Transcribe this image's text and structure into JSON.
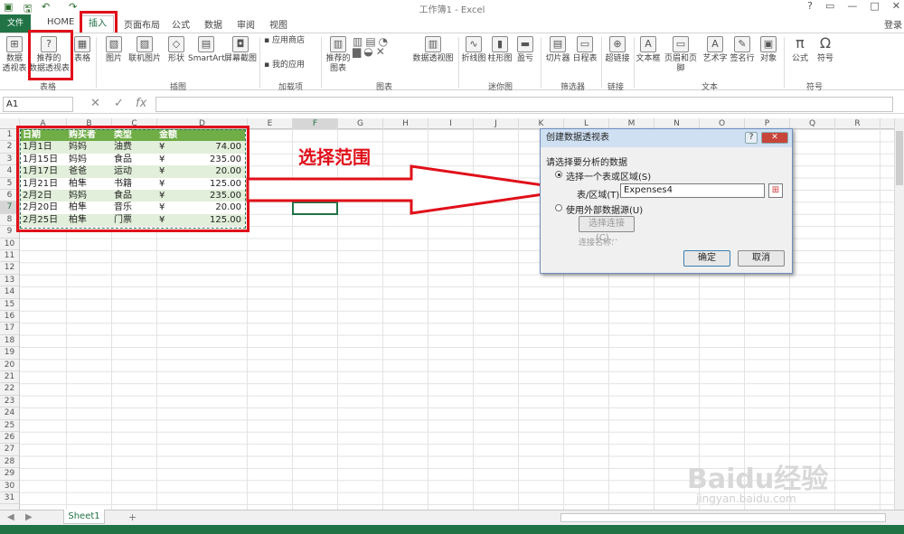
{
  "window": {
    "title": "工作簿1 - Excel",
    "login": "登录",
    "controls": [
      "?",
      "▭",
      "—",
      "□",
      "✕"
    ]
  },
  "tabs": [
    {
      "label": "文件"
    },
    {
      "label": "HOME"
    },
    {
      "label": "插入"
    },
    {
      "label": "页面布局"
    },
    {
      "label": "公式"
    },
    {
      "label": "数据"
    },
    {
      "label": "审阅"
    },
    {
      "label": "视图"
    }
  ],
  "ribbon": {
    "buttons": [
      {
        "label": "数据\n透视表"
      },
      {
        "label": "推荐的\n数据透视表"
      },
      {
        "label": "表格"
      },
      {
        "label": "图片"
      },
      {
        "label": "联机图片"
      },
      {
        "label": "形状"
      },
      {
        "label": "SmartArt"
      },
      {
        "label": "屏幕截图"
      },
      {
        "label": "应用商店"
      },
      {
        "label": "我的应用"
      },
      {
        "label": "推荐的\n图表"
      },
      {
        "label": "数据透视图"
      },
      {
        "label": "折线图"
      },
      {
        "label": "柱形图"
      },
      {
        "label": "盈亏"
      },
      {
        "label": "切片器"
      },
      {
        "label": "日程表"
      },
      {
        "label": "超链接"
      },
      {
        "label": "文本框"
      },
      {
        "label": "页眉和页脚"
      },
      {
        "label": "艺术字"
      },
      {
        "label": "签名行"
      },
      {
        "label": "对象"
      },
      {
        "label": "公式"
      },
      {
        "label": "符号"
      }
    ],
    "groups": [
      "表格",
      "插图",
      "加载项",
      "图表",
      "迷你图",
      "筛选器",
      "链接",
      "文本",
      "符号"
    ]
  },
  "formula_bar": {
    "name_box": "A1",
    "icons": [
      "✕",
      "✓",
      "fx"
    ],
    "value": ""
  },
  "columns": [
    "A",
    "B",
    "C",
    "D",
    "E",
    "F",
    "G",
    "H",
    "I",
    "J",
    "K",
    "L",
    "M",
    "N",
    "O",
    "P",
    "Q",
    "R"
  ],
  "rows": [
    "1",
    "2",
    "3",
    "4",
    "5",
    "6",
    "7",
    "8",
    "9",
    "10",
    "11",
    "12",
    "13",
    "14",
    "15",
    "16",
    "17",
    "18",
    "19",
    "20",
    "21",
    "22",
    "23",
    "24",
    "25",
    "26",
    "27",
    "28",
    "29",
    "30",
    "31"
  ],
  "table": {
    "headers": [
      "日期",
      "购买者",
      "类型",
      "金额"
    ],
    "rows": [
      {
        "date": "1月1日",
        "buyer": "妈妈",
        "type": "油费",
        "cur": "¥",
        "amount": "74.00"
      },
      {
        "date": "1月15日",
        "buyer": "妈妈",
        "type": "食品",
        "cur": "¥",
        "amount": "235.00"
      },
      {
        "date": "1月17日",
        "buyer": "爸爸",
        "type": "运动",
        "cur": "¥",
        "amount": "20.00"
      },
      {
        "date": "1月21日",
        "buyer": "柏隼",
        "type": "书籍",
        "cur": "¥",
        "amount": "125.00"
      },
      {
        "date": "2月2日",
        "buyer": "妈妈",
        "type": "食品",
        "cur": "¥",
        "amount": "235.00"
      },
      {
        "date": "2月20日",
        "buyer": "柏隼",
        "type": "音乐",
        "cur": "¥",
        "amount": "20.00"
      },
      {
        "date": "2月25日",
        "buyer": "柏隼",
        "type": "门票",
        "cur": "¥",
        "amount": "125.00"
      }
    ]
  },
  "annotation": "选择范围",
  "dialog": {
    "title": "创建数据透视表",
    "help": "?",
    "close": "✕",
    "section": "请选择要分析的数据",
    "opt_table": "选择一个表或区域(S)",
    "range_label": "表/区域(T):",
    "range_value": "Expenses4",
    "opt_external": "使用外部数据源(U)",
    "choose_conn": "选择连接(C)...",
    "conn_name": "连接名称:",
    "ok": "确定",
    "cancel": "取消"
  },
  "sheet": {
    "tab": "Sheet1",
    "add": "+"
  },
  "watermark": {
    "brand": "Baidu经验",
    "url": "jingyan.baidu.com"
  },
  "colors": {
    "excel_green": "#217346",
    "table_header": "#70ad47",
    "table_band": "#e2efda",
    "annotation_red": "#e0101a"
  }
}
